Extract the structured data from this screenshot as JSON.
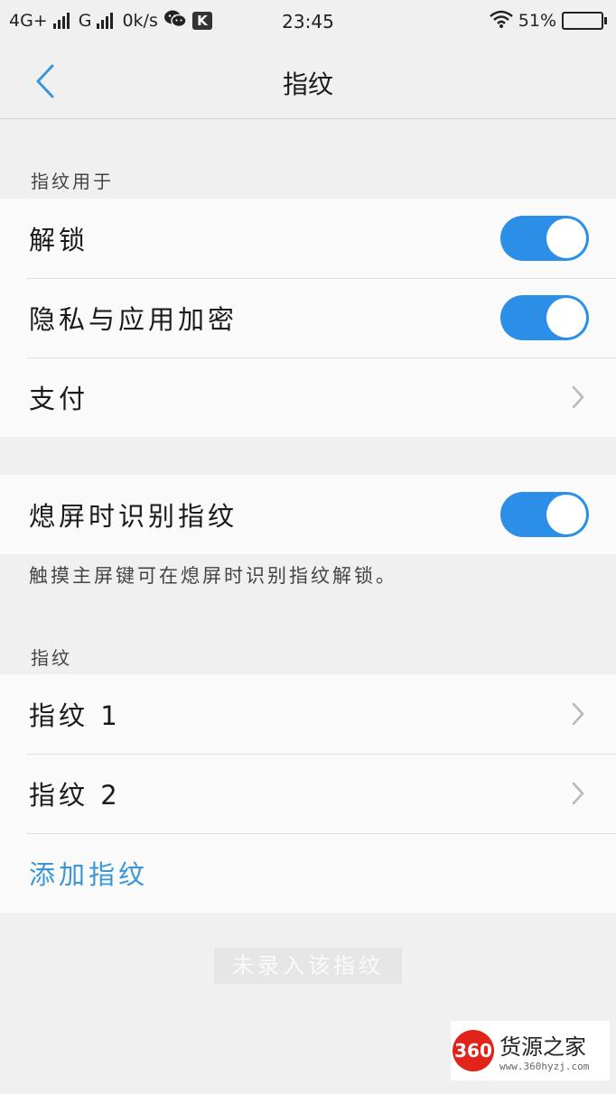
{
  "status_bar": {
    "network_1": "4G+",
    "network_2": "G",
    "speed": "0k/s",
    "app_badge": "K",
    "time": "23:45",
    "battery": "51%",
    "battery_level": 0.51,
    "icons": [
      "signal-bars-icon",
      "wechat-icon",
      "wifi-icon",
      "battery-icon"
    ]
  },
  "header": {
    "title": "指纹",
    "back_icon": "chevron-left-icon"
  },
  "section_usage": {
    "label": "指纹用于",
    "items": [
      {
        "label": "解锁",
        "control": "toggle",
        "on": true
      },
      {
        "label": "隐私与应用加密",
        "control": "toggle",
        "on": true
      },
      {
        "label": "支付",
        "control": "chevron"
      }
    ]
  },
  "screen_off": {
    "label": "熄屏时识别指纹",
    "on": true,
    "helper": "触摸主屏键可在熄屏时识别指纹解锁。"
  },
  "section_fingerprints": {
    "label": "指纹",
    "items": [
      {
        "label": "指纹 1"
      },
      {
        "label": "指纹 2"
      }
    ],
    "add_label": "添加指纹"
  },
  "toast": "未录入该指纹",
  "watermark": {
    "logo": "360",
    "name": "货源之家",
    "url": "www.360hyzj.com"
  },
  "colors": {
    "accent": "#2b8fe8",
    "link": "#3a96d8",
    "background": "#f0f0f0",
    "card": "#fafafa"
  }
}
